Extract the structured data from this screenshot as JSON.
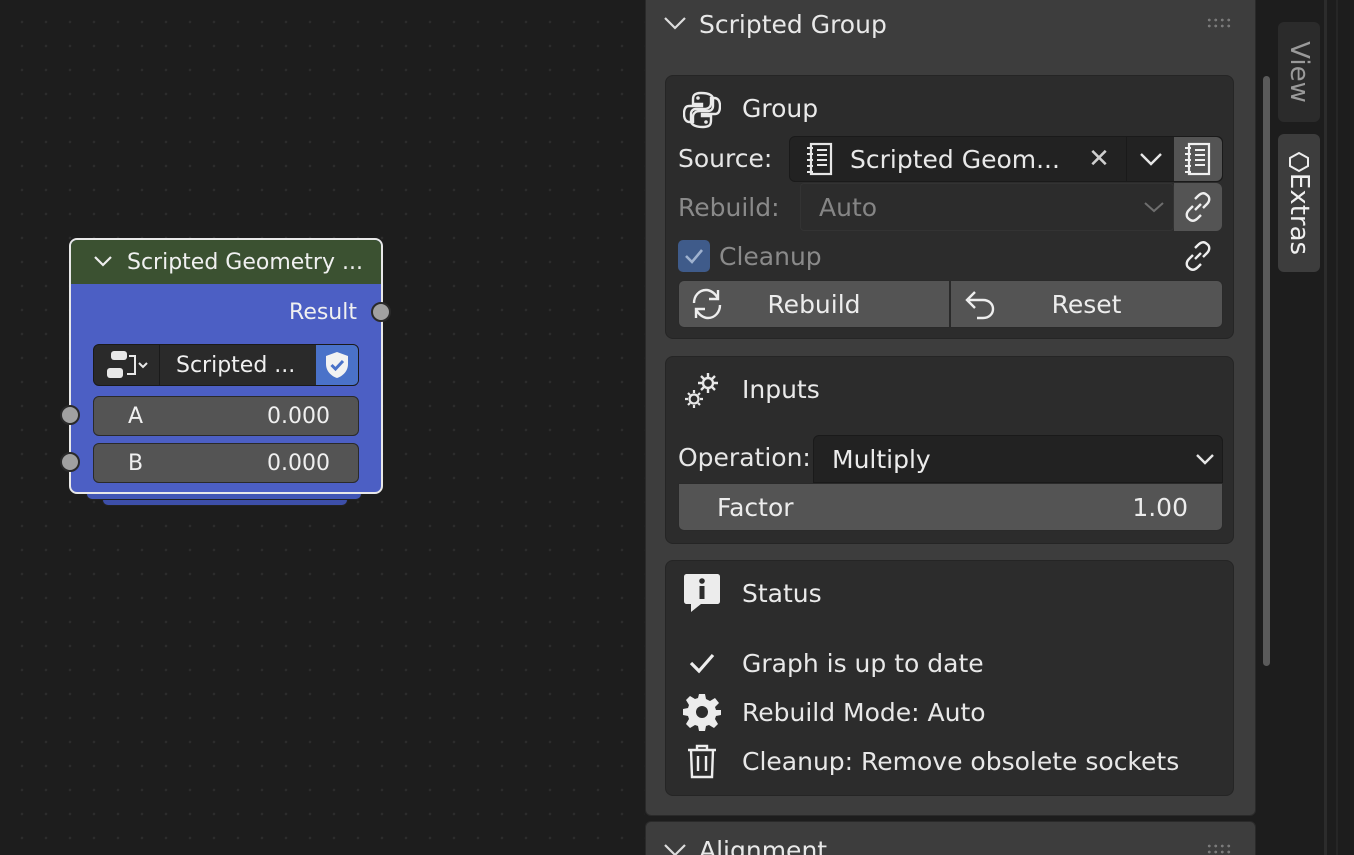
{
  "node": {
    "title": "Scripted Geometry ...",
    "output_label": "Result",
    "selector_name": "Scripted ...",
    "inputs": [
      {
        "label": "A",
        "value": "0.000"
      },
      {
        "label": "B",
        "value": "0.000"
      }
    ]
  },
  "sidebar": {
    "panel_title": "Scripted Group",
    "group": {
      "title": "Group",
      "source_label": "Source:",
      "source_value": "Scripted Geom...",
      "rebuild_label": "Rebuild:",
      "rebuild_value": "Auto",
      "cleanup_label": "Cleanup",
      "rebuild_button": "Rebuild",
      "reset_button": "Reset"
    },
    "inputs": {
      "title": "Inputs",
      "operation_label": "Operation:",
      "operation_value": "Multiply",
      "factor_label": "Factor",
      "factor_value": "1.00"
    },
    "status": {
      "title": "Status",
      "items": [
        {
          "icon": "check-icon",
          "text": "Graph is up to date"
        },
        {
          "icon": "gear-icon",
          "text": "Rebuild Mode: Auto"
        },
        {
          "icon": "trash-icon",
          "text": "Cleanup: Remove obsolete sockets"
        }
      ]
    },
    "next_panel_title": "Alignment"
  },
  "tabs": [
    {
      "label": "View",
      "active": false
    },
    {
      "label": "Extras",
      "active": true
    }
  ],
  "colors": {
    "node_body": "#4c5fc4",
    "node_header": "#3b5131",
    "accent_blue": "#4a72c9",
    "checkbox": "#3f5b8a"
  }
}
